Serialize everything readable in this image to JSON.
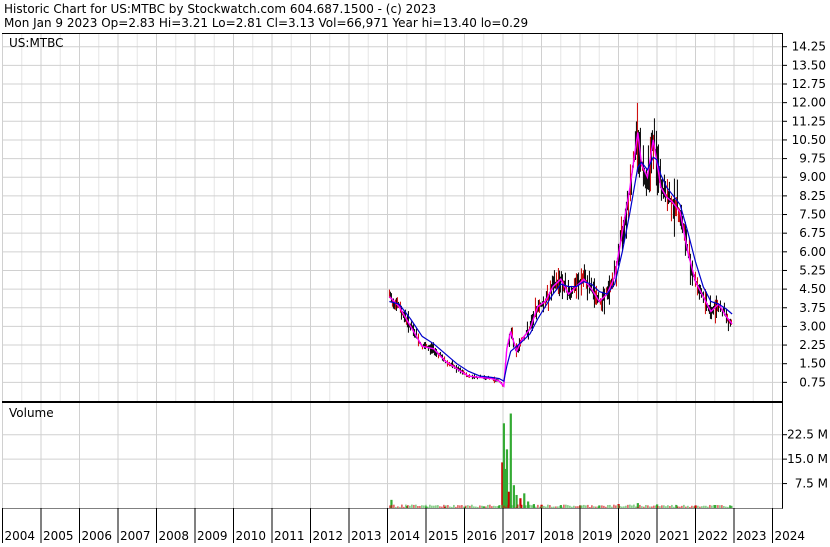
{
  "header": {
    "line1": "Historic Chart for US:MTBC by Stockwatch.com 604.687.1500 - (c) 2023",
    "line2": "Mon Jan  9 2023   Op=2.83  Hi=3.21  Lo=2.81  Cl=3.13  Vol=66,971  Year hi=13.40  lo=0.29"
  },
  "colors": {
    "background": "#ffffff",
    "grid": "#d0d0d0",
    "frame": "#000000",
    "price_bars": "#000000",
    "price_down": "#cc0000",
    "ma_short": "#ff00ff",
    "ma_long": "#0000cc",
    "volume_up": "#33aa33",
    "volume_down": "#cc0000"
  },
  "chart_data": [
    {
      "type": "line",
      "title": "US:MTBC",
      "ylim": [
        0,
        14.6
      ],
      "y_ticks": [
        "0.75",
        "1.50",
        "2.25",
        "3.00",
        "3.75",
        "4.50",
        "5.25",
        "6.00",
        "6.75",
        "7.50",
        "8.25",
        "9.00",
        "9.75",
        "10.50",
        "11.25",
        "12.00",
        "12.75",
        "13.50",
        "14.25"
      ],
      "x": [
        2014.05,
        2014.3,
        2014.6,
        2014.9,
        2015.2,
        2015.5,
        2015.8,
        2016.1,
        2016.4,
        2016.7,
        2016.9,
        2017.02,
        2017.1,
        2017.2,
        2017.35,
        2017.5,
        2017.7,
        2017.9,
        2018.1,
        2018.3,
        2018.5,
        2018.7,
        2018.9,
        2019.1,
        2019.3,
        2019.5,
        2019.7,
        2019.9,
        2020.1,
        2020.3,
        2020.5,
        2020.6,
        2020.75,
        2020.9,
        2021.0,
        2021.1,
        2021.25,
        2021.4,
        2021.6,
        2021.8,
        2022.0,
        2022.2,
        2022.4,
        2022.6,
        2022.8,
        2022.95
      ],
      "series": [
        {
          "values": [
            4.2,
            3.8,
            3.0,
            2.2,
            2.1,
            1.6,
            1.3,
            1.0,
            0.95,
            0.9,
            0.8,
            0.6,
            2.1,
            2.8,
            2.0,
            2.5,
            2.9,
            3.8,
            4.0,
            4.6,
            4.9,
            4.3,
            4.6,
            4.9,
            4.5,
            4.0,
            4.3,
            5.0,
            6.8,
            8.6,
            10.8,
            9.5,
            9.0,
            10.5,
            9.6,
            8.6,
            8.2,
            8.0,
            7.6,
            6.0,
            4.8,
            4.2,
            3.6,
            3.9,
            3.4,
            3.1
          ]
        },
        {
          "values": [
            4.0,
            3.9,
            3.3,
            2.6,
            2.3,
            1.9,
            1.5,
            1.2,
            1.0,
            0.95,
            0.9,
            0.8,
            1.4,
            2.0,
            2.2,
            2.4,
            2.7,
            3.3,
            3.8,
            4.3,
            4.7,
            4.6,
            4.6,
            4.8,
            4.7,
            4.4,
            4.3,
            4.7,
            6.0,
            7.6,
            9.4,
            9.6,
            9.3,
            9.8,
            9.7,
            9.1,
            8.6,
            8.3,
            7.9,
            6.8,
            5.6,
            4.6,
            4.0,
            3.9,
            3.7,
            3.5
          ]
        }
      ]
    },
    {
      "type": "bar",
      "title": "Volume",
      "ylim": [
        0,
        31
      ],
      "y_ticks": [
        "7.5 M",
        "15.0 M",
        "22.5 M"
      ],
      "x": [
        2014.1,
        2014.5,
        2015.0,
        2015.5,
        2016.0,
        2016.5,
        2016.9,
        2016.98,
        2017.02,
        2017.05,
        2017.1,
        2017.15,
        2017.2,
        2017.28,
        2017.35,
        2017.45,
        2017.55,
        2017.65,
        2017.8,
        2018.0,
        2018.5,
        2019.0,
        2019.5,
        2020.0,
        2020.5,
        2021.0,
        2021.5,
        2022.0,
        2022.5,
        2022.9
      ],
      "values": [
        2.5,
        0.6,
        0.5,
        0.4,
        0.4,
        0.5,
        0.8,
        14,
        26,
        12,
        18,
        5,
        29,
        7,
        4,
        3,
        4.5,
        2,
        1.2,
        1.0,
        0.9,
        0.8,
        0.8,
        1.2,
        1.5,
        1.1,
        0.9,
        0.8,
        0.9,
        0.7
      ]
    }
  ],
  "x_axis": {
    "tick_labels": [
      "2004",
      "2005",
      "2006",
      "2007",
      "2008",
      "2009",
      "2010",
      "2011",
      "2012",
      "2013",
      "2014",
      "2015",
      "2016",
      "2017",
      "2018",
      "2019",
      "2020",
      "2021",
      "2022",
      "2023",
      "2024"
    ]
  }
}
